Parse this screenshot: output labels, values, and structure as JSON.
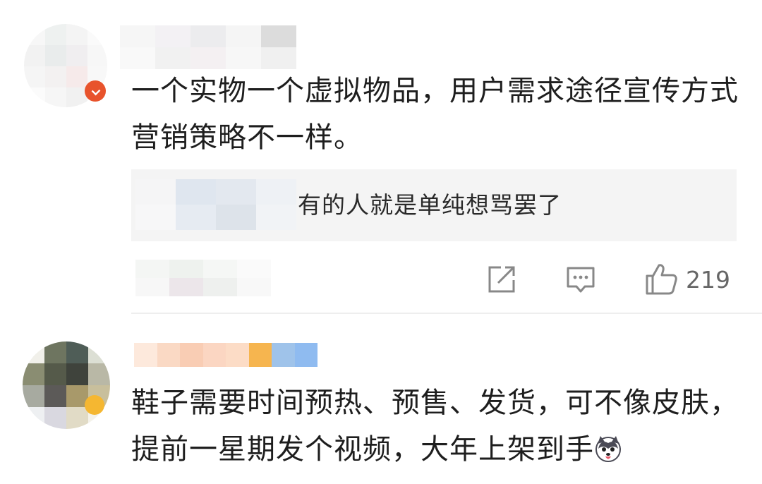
{
  "comments": [
    {
      "text": "一个实物一个虚拟物品，用户需求途径宣传方式营销策略不一样。",
      "reply": {
        "text": "有的人就是单纯想骂罢了"
      },
      "like_count": "219",
      "icons": [
        "share-icon",
        "comment-icon",
        "thumb-up-icon"
      ]
    },
    {
      "text": "鞋子需要时间预热、预售、发货，可不像皮肤，提前一星期发个视频，大年上架到手",
      "emoji": "husky-emoji"
    }
  ],
  "colors": {
    "background": "#ffffff",
    "text": "#1e1e1e",
    "reply_bg": "#f4f4f4",
    "icon_gray": "#888888",
    "badge_red": "#e8532c",
    "badge_gold": "#f5b731",
    "divider": "#eeeeee"
  }
}
